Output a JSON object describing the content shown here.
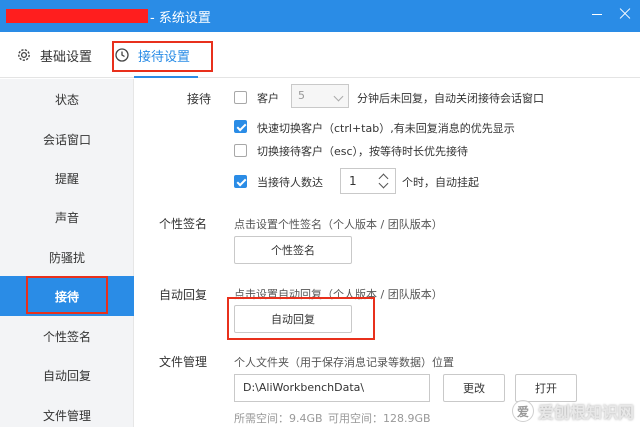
{
  "window": {
    "title": "- 系统设置",
    "colors": {
      "titlebar": "#2a8ce6",
      "accent": "#2a8ce6",
      "highlight_box": "#e8301c"
    }
  },
  "tabs": [
    {
      "label": "基础设置",
      "icon": "gear-icon"
    },
    {
      "label": "接待设置",
      "icon": "clock-icon",
      "active": true
    }
  ],
  "sidebar": {
    "items": [
      {
        "label": "状态"
      },
      {
        "label": "会话窗口"
      },
      {
        "label": "提醒"
      },
      {
        "label": "声音"
      },
      {
        "label": "防骚扰"
      },
      {
        "label": "接待",
        "active": true
      },
      {
        "label": "个性签名"
      },
      {
        "label": "自动回复"
      },
      {
        "label": "文件管理"
      }
    ]
  },
  "reception": {
    "label": "接待",
    "auto_close": {
      "checked": false,
      "prefix": "客户",
      "minutes": "5",
      "suffix": "分钟后未回复，自动关闭接待会话窗口"
    },
    "fast_switch": {
      "checked": true,
      "text": "快速切换客户（ctrl+tab）,有未回复消息的优先显示"
    },
    "switch_reception": {
      "checked": false,
      "text": "切换接待客户（esc），按等待时长优先接待"
    },
    "auto_hang": {
      "checked": true,
      "prefix": "当接待人数达",
      "count": "1",
      "suffix": "个时，自动挂起"
    }
  },
  "signature": {
    "label": "个性签名",
    "hint": "点击设置个性签名（个人版本 / 团队版本）",
    "button": "个性签名"
  },
  "auto_reply": {
    "label": "自动回复",
    "hint": "点击设置自动回复（个人版本 / 团队版本）",
    "button": "自动回复"
  },
  "file_mgmt": {
    "label": "文件管理",
    "hint": "个人文件夹（用于保存消息记录等数据）位置",
    "path": "D:\\AliWorkbenchData\\",
    "change_button": "更改",
    "open_button": "打开",
    "used_space": "所需空间：9.4GB",
    "free_space": "可用空间：128.9GB"
  },
  "watermark": {
    "text": "爱刨根知识网",
    "logo": "爱"
  }
}
